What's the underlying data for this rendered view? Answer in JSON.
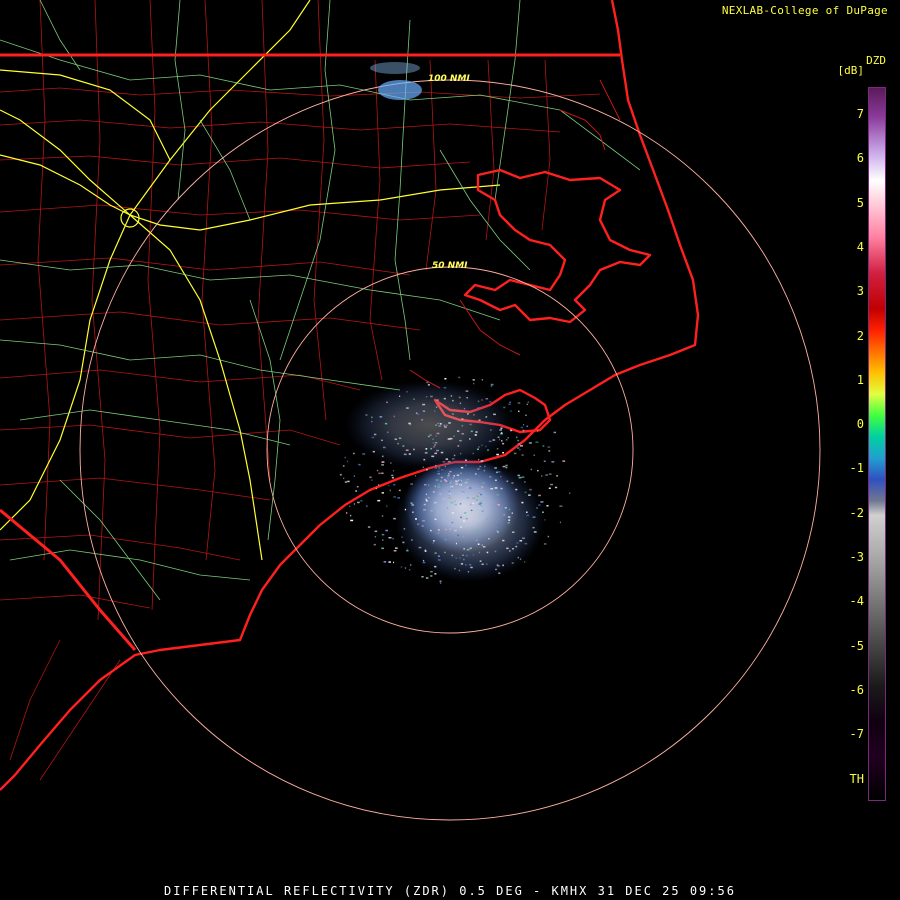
{
  "header": {
    "credit": "NEXLAB-College of DuPage"
  },
  "footer": {
    "caption": "DIFFERENTIAL REFLECTIVITY (ZDR) 0.5 DEG - KMHX 31 DEC 25 09:56"
  },
  "legend": {
    "product": "DZD",
    "unit": "[dB]",
    "ticks": [
      "7",
      "6",
      "5",
      "4",
      "3",
      "2",
      "1",
      "0",
      "-1",
      "-2",
      "-3",
      "-4",
      "-5",
      "-6",
      "-7",
      "TH"
    ]
  },
  "range_rings": {
    "inner": "50 NMI",
    "outer": "100 NMI"
  },
  "colors": {
    "state_border": "#ff2020",
    "county_border": "#c81818",
    "highway": "#ffff30",
    "road": "#90f090",
    "range_ring": "#ffb0a0",
    "text": "#ffff40"
  }
}
